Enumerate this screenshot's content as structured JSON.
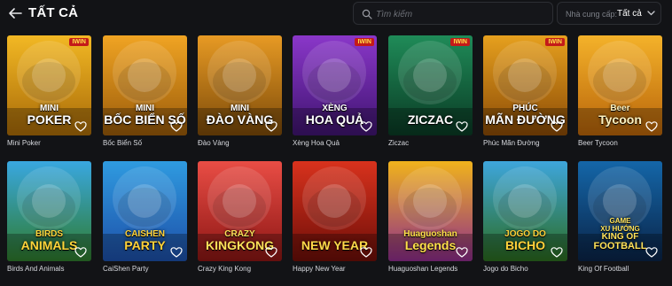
{
  "header": {
    "title": "TẤT CẢ",
    "search_placeholder": "Tìm kiếm",
    "provider_label": "Nhà cung cấp:",
    "provider_value": "Tất cả"
  },
  "games": [
    {
      "name": "Mini Poker",
      "art": [
        "MINI",
        "POKER"
      ],
      "bg1": "#f2b824",
      "bg2": "#a86a08",
      "text": "#ffffff",
      "badge": "IWIN"
    },
    {
      "name": "Bốc Biển Số",
      "art": [
        "MINI",
        "BỐC BIỂN SỐ"
      ],
      "bg1": "#f0a423",
      "bg2": "#9a5b0a",
      "text": "#ffffff",
      "badge": ""
    },
    {
      "name": "Đào Vàng",
      "art": [
        "MINI",
        "ĐÀO VÀNG"
      ],
      "bg1": "#e79a24",
      "bg2": "#7c4a09",
      "text": "#ffffff",
      "badge": ""
    },
    {
      "name": "Xèng Hoa Quả",
      "art": [
        "XÈNG",
        "HOA QUẢ"
      ],
      "bg1": "#8a37c9",
      "bg2": "#3f1470",
      "text": "#ffffff",
      "badge": "IWIN"
    },
    {
      "name": "Ziczac",
      "art": [
        "ZICZAC"
      ],
      "bg1": "#1f8b58",
      "bg2": "#0a3a24",
      "text": "#ffffff",
      "badge": "IWIN"
    },
    {
      "name": "Phúc Mãn Đường",
      "art": [
        "PHÚC",
        "MÃN ĐƯỜNG"
      ],
      "bg1": "#e6a01e",
      "bg2": "#8a4a06",
      "text": "#ffffff",
      "badge": "IWIN"
    },
    {
      "name": "Beer Tycoon",
      "art": [
        "Beer",
        "Tycoon"
      ],
      "bg1": "#f4b22a",
      "bg2": "#b8640a",
      "text": "#fff3c0",
      "badge": ""
    },
    {
      "name": "Birds And Animals",
      "art": [
        "BIRDS",
        "ANIMALS"
      ],
      "bg1": "#39a7e0",
      "bg2": "#2f7b2c",
      "text": "#ffd53a",
      "badge": ""
    },
    {
      "name": "CaiShen Party",
      "art": [
        "CAISHEN",
        "PARTY"
      ],
      "bg1": "#2f9be0",
      "bg2": "#1d4fa8",
      "text": "#ffd23a",
      "badge": ""
    },
    {
      "name": "Crazy King Kong",
      "art": [
        "CRAZY",
        "KINGKONG"
      ],
      "bg1": "#e94d45",
      "bg2": "#8c1614",
      "text": "#ffe15a",
      "badge": ""
    },
    {
      "name": "Happy New Year",
      "art": [
        "NEW YEAR"
      ],
      "bg1": "#d8321d",
      "bg2": "#6e0e08",
      "text": "#ffd94a",
      "badge": ""
    },
    {
      "name": "Huaguoshan Legends",
      "art": [
        "Huaguoshan",
        "Legends"
      ],
      "bg1": "#f0b31c",
      "bg2": "#8e2d8a",
      "text": "#ffe04a",
      "badge": ""
    },
    {
      "name": "Jogo do Bicho",
      "art": [
        "JOGO DO",
        "BICHO"
      ],
      "bg1": "#3ea6dc",
      "bg2": "#2b6b1f",
      "text": "#ffd13a",
      "badge": ""
    },
    {
      "name": "King Of Football",
      "art": [
        "GAME",
        "XU HƯỚNG",
        "KING OF",
        "FOOTBALL"
      ],
      "bg1": "#1466a8",
      "bg2": "#0a2448",
      "text": "#ffe25a",
      "badge": ""
    }
  ]
}
